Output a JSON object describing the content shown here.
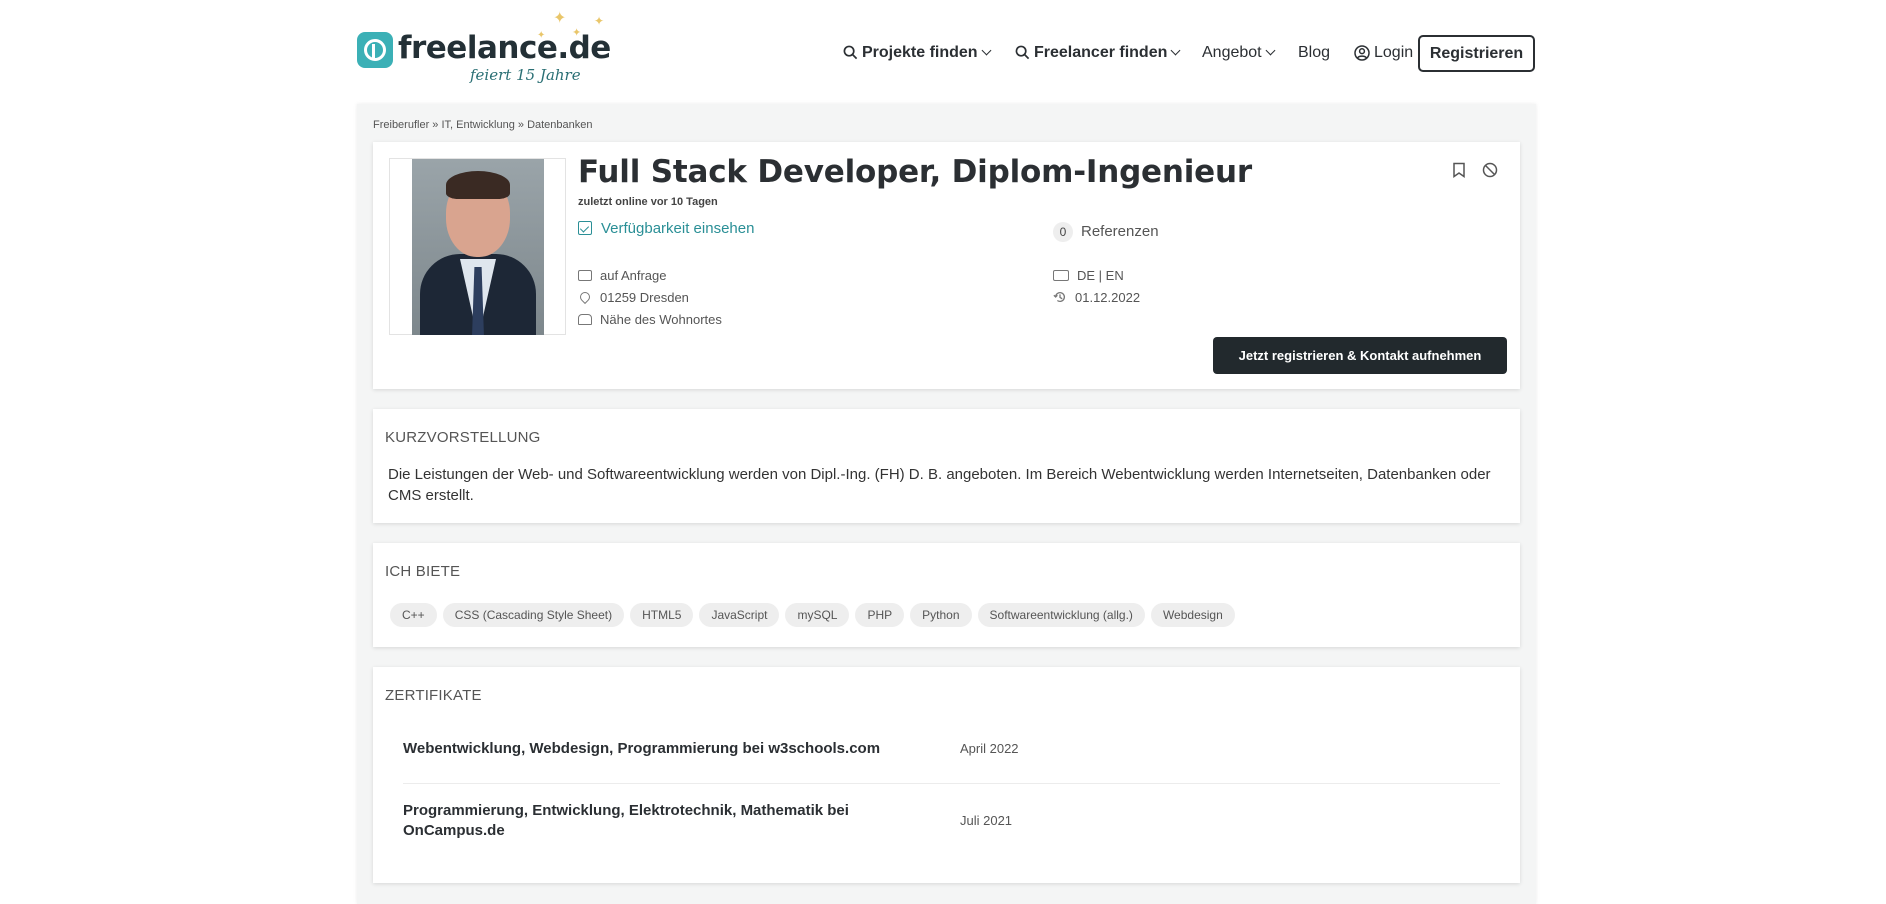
{
  "header": {
    "logo_text": "freelance.de",
    "logo_subtitle": "feiert 15 Jahre",
    "nav": {
      "projects": "Projekte finden",
      "freelancers": "Freelancer finden",
      "offer": "Angebot",
      "blog": "Blog",
      "login": "Login",
      "register": "Registrieren"
    }
  },
  "breadcrumb": "Freiberufler » IT, Entwicklung » Datenbanken",
  "profile": {
    "title": "Full Stack Developer, Diplom-Ingenieur",
    "last_online": "zuletzt online vor 10 Tagen",
    "availability_link": "Verfügbarkeit einsehen",
    "rate": "auf Anfrage",
    "location": "01259 Dresden",
    "travel": "Nähe des Wohnortes",
    "references_count": "0",
    "references_label": "Referenzen",
    "languages": "DE | EN",
    "date": "01.12.2022",
    "cta": "Jetzt registrieren & Kontakt aufnehmen"
  },
  "kurzvorstellung": {
    "heading": "Kurzvorstellung",
    "text": "Die Leistungen der Web- und Softwareentwicklung werden von Dipl.-Ing. (FH) D. B. angeboten. Im Bereich Webentwicklung werden Internetseiten, Datenbanken oder CMS erstellt."
  },
  "ich_biete": {
    "heading": "Ich biete",
    "tags": [
      "C++",
      "CSS (Cascading Style Sheet)",
      "HTML5",
      "JavaScript",
      "mySQL",
      "PHP",
      "Python",
      "Softwareentwicklung (allg.)",
      "Webdesign"
    ]
  },
  "zertifikate": {
    "heading": "Zertifikate",
    "items": [
      {
        "name": "Webentwicklung, Webdesign, Programmierung bei w3schools.com",
        "date": "April 2022"
      },
      {
        "name": "Programmierung, Entwicklung, Elektrotechnik, Mathematik bei OnCampus.de",
        "date": "Juli 2021"
      }
    ]
  },
  "colors": {
    "accent": "#2a8f96",
    "dark": "#22292d"
  }
}
